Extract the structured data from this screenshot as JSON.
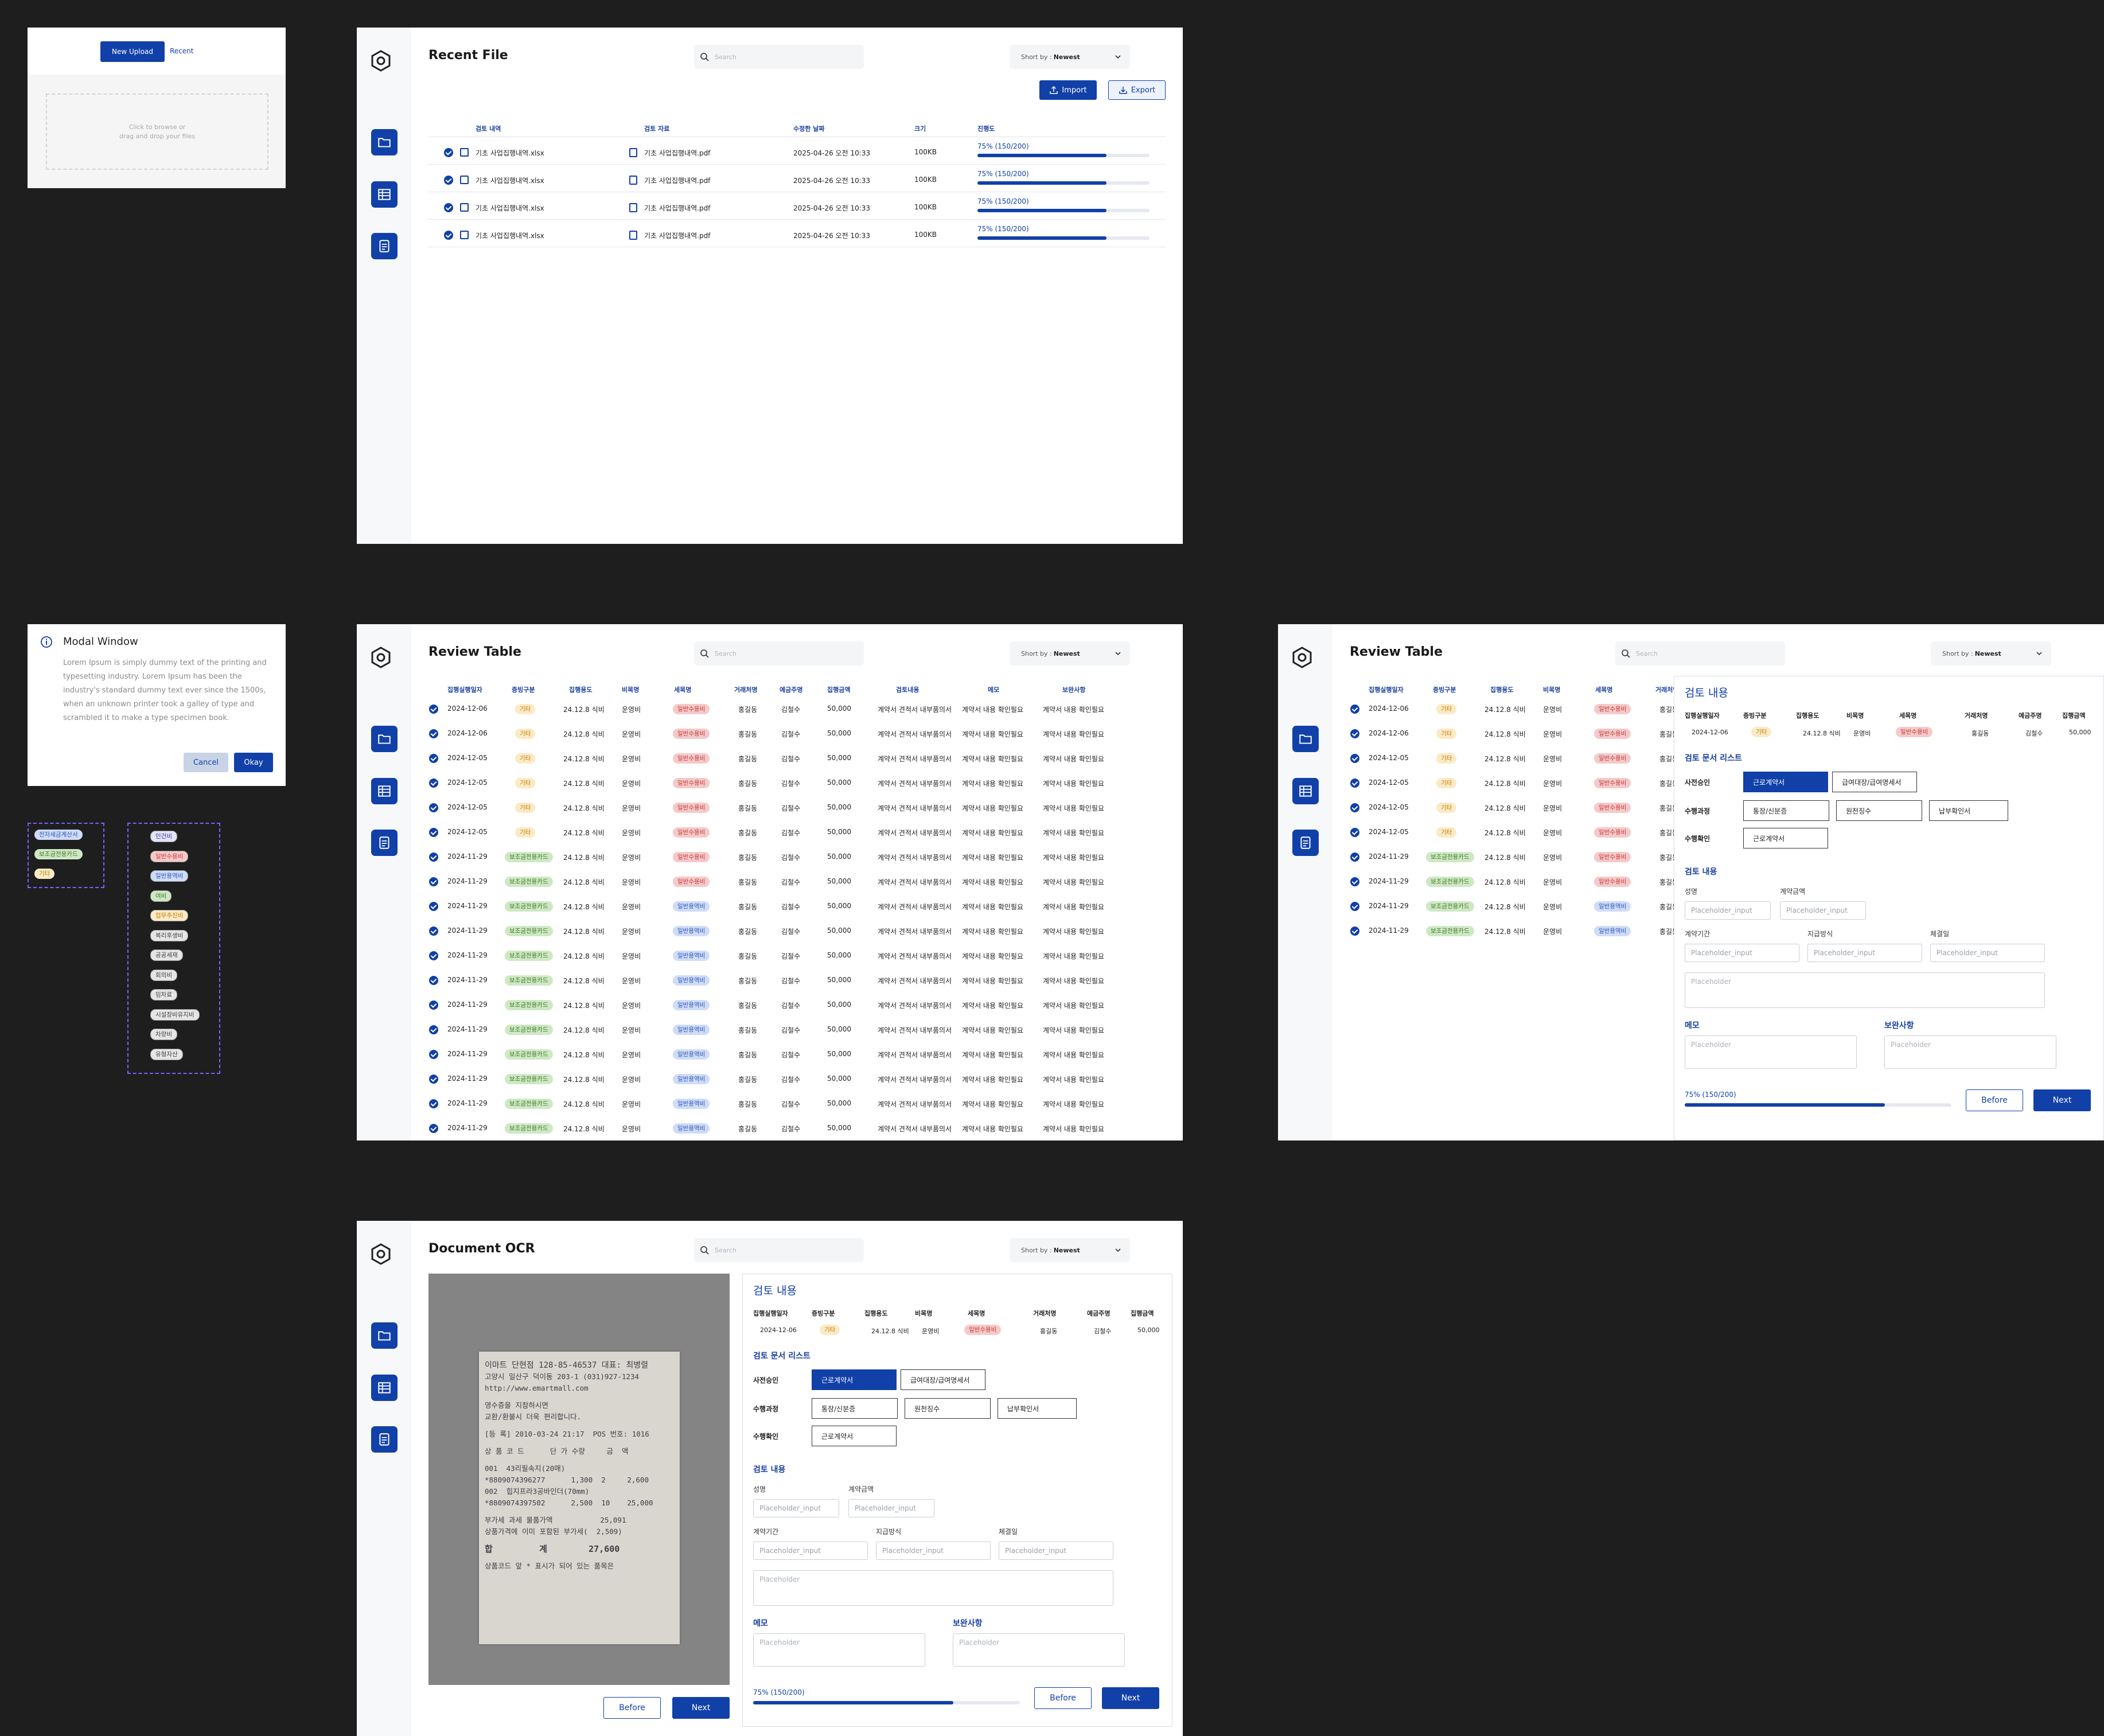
{
  "upload": {
    "tab_new": "New Upload",
    "tab_recent": "Recent",
    "drop_line1": "Click to browse or",
    "drop_line2": "drag and drop your files"
  },
  "modal": {
    "title": "Modal Window",
    "body": "Lorem Ipsum is simply dummy text of the printing and typesetting industry. Lorem Ipsum has been the industry's standard dummy text ever since the 1500s, when an unknown printer took a galley of type and scrambled it to make a type specimen book.",
    "cancel": "Cancel",
    "okay": "Okay"
  },
  "legend_a": [
    "전자세금계산서",
    "보조금전용카드",
    "기타"
  ],
  "legend_b": [
    "인건비",
    "일반수용비",
    "일반용역비",
    "여비",
    "업무추진비",
    "복리후생비",
    "공공세재",
    "회의비",
    "임차료",
    "시설장비유지비",
    "차량비",
    "유형자산"
  ],
  "common": {
    "search_placeholder": "Search",
    "sort_label": "Short by :",
    "sort_value": "Newest"
  },
  "recent": {
    "title": "Recent File",
    "import": "Import",
    "export": "Export",
    "columns": [
      "검토 내역",
      "검토 자료",
      "수정한 날짜",
      "크기",
      "진행도"
    ],
    "rows": [
      {
        "name": "기초 사업집행내역.xlsx",
        "doc": "기초 사업집행내역.pdf",
        "date": "2025-04-26 오전 10:33",
        "size": "100KB",
        "progress": "75% (150/200)",
        "pct": 0.75
      },
      {
        "name": "기초 사업집행내역.xlsx",
        "doc": "기초 사업집행내역.pdf",
        "date": "2025-04-26 오전 10:33",
        "size": "100KB",
        "progress": "75% (150/200)",
        "pct": 0.75
      },
      {
        "name": "기초 사업집행내역.xlsx",
        "doc": "기초 사업집행내역.pdf",
        "date": "2025-04-26 오전 10:33",
        "size": "100KB",
        "progress": "75% (150/200)",
        "pct": 0.75
      },
      {
        "name": "기초 사업집행내역.xlsx",
        "doc": "기초 사업집행내역.pdf",
        "date": "2025-04-26 오전 10:33",
        "size": "100KB",
        "progress": "75% (150/200)",
        "pct": 0.75
      }
    ]
  },
  "review": {
    "title": "Review Table",
    "columns": [
      "집행실행일자",
      "증빙구분",
      "집행용도",
      "비목명",
      "세목명",
      "거래처명",
      "예금주명",
      "집행금액",
      "검토내용",
      "메모",
      "보완사항"
    ],
    "rows": [
      {
        "date": "2024-12-06",
        "type": "기타",
        "tt": "y",
        "use": "24.12.8 식비",
        "item": "운영비",
        "sub": "일반수용비",
        "st": "r",
        "vendor": "홍길동",
        "holder": "김철수",
        "amount": "50,000",
        "review": "계약서 견적서 내부품의서",
        "memo": "계약서 내용 확인필요",
        "fix": "계약서 내용 확인필요"
      },
      {
        "date": "2024-12-06",
        "type": "기타",
        "tt": "y",
        "use": "24.12.8 식비",
        "item": "운영비",
        "sub": "일반수용비",
        "st": "r",
        "vendor": "홍길동",
        "holder": "김철수",
        "amount": "50,000",
        "review": "계약서 견적서 내부품의서",
        "memo": "계약서 내용 확인필요",
        "fix": "계약서 내용 확인필요"
      },
      {
        "date": "2024-12-05",
        "type": "기타",
        "tt": "y",
        "use": "24.12.8 식비",
        "item": "운영비",
        "sub": "일반수용비",
        "st": "r",
        "vendor": "홍길동",
        "holder": "김철수",
        "amount": "50,000",
        "review": "계약서 견적서 내부품의서",
        "memo": "계약서 내용 확인필요",
        "fix": "계약서 내용 확인필요"
      },
      {
        "date": "2024-12-05",
        "type": "기타",
        "tt": "y",
        "use": "24.12.8 식비",
        "item": "운영비",
        "sub": "일반수용비",
        "st": "r",
        "vendor": "홍길동",
        "holder": "김철수",
        "amount": "50,000",
        "review": "계약서 견적서 내부품의서",
        "memo": "계약서 내용 확인필요",
        "fix": "계약서 내용 확인필요"
      },
      {
        "date": "2024-12-05",
        "type": "기타",
        "tt": "y",
        "use": "24.12.8 식비",
        "item": "운영비",
        "sub": "일반수용비",
        "st": "r",
        "vendor": "홍길동",
        "holder": "김철수",
        "amount": "50,000",
        "review": "계약서 견적서 내부품의서",
        "memo": "계약서 내용 확인필요",
        "fix": "계약서 내용 확인필요"
      },
      {
        "date": "2024-12-05",
        "type": "기타",
        "tt": "y",
        "use": "24.12.8 식비",
        "item": "운영비",
        "sub": "일반수용비",
        "st": "r",
        "vendor": "홍길동",
        "holder": "김철수",
        "amount": "50,000",
        "review": "계약서 견적서 내부품의서",
        "memo": "계약서 내용 확인필요",
        "fix": "계약서 내용 확인필요"
      },
      {
        "date": "2024-11-29",
        "type": "보조금전용카드",
        "tt": "g",
        "use": "24.12.8 식비",
        "item": "운영비",
        "sub": "일반수용비",
        "st": "r",
        "vendor": "홍길동",
        "holder": "김철수",
        "amount": "50,000",
        "review": "계약서 견적서 내부품의서",
        "memo": "계약서 내용 확인필요",
        "fix": "계약서 내용 확인필요"
      },
      {
        "date": "2024-11-29",
        "type": "보조금전용카드",
        "tt": "g",
        "use": "24.12.8 식비",
        "item": "운영비",
        "sub": "일반수용비",
        "st": "r",
        "vendor": "홍길동",
        "holder": "김철수",
        "amount": "50,000",
        "review": "계약서 견적서 내부품의서",
        "memo": "계약서 내용 확인필요",
        "fix": "계약서 내용 확인필요"
      },
      {
        "date": "2024-11-29",
        "type": "보조금전용카드",
        "tt": "g",
        "use": "24.12.8 식비",
        "item": "운영비",
        "sub": "일반용역비",
        "st": "b",
        "vendor": "홍길동",
        "holder": "김철수",
        "amount": "50,000",
        "review": "계약서 견적서 내부품의서",
        "memo": "계약서 내용 확인필요",
        "fix": "계약서 내용 확인필요"
      },
      {
        "date": "2024-11-29",
        "type": "보조금전용카드",
        "tt": "g",
        "use": "24.12.8 식비",
        "item": "운영비",
        "sub": "일반용역비",
        "st": "b",
        "vendor": "홍길동",
        "holder": "김철수",
        "amount": "50,000",
        "review": "계약서 견적서 내부품의서",
        "memo": "계약서 내용 확인필요",
        "fix": "계약서 내용 확인필요"
      },
      {
        "date": "2024-11-29",
        "type": "보조금전용카드",
        "tt": "g",
        "use": "24.12.8 식비",
        "item": "운영비",
        "sub": "일반용역비",
        "st": "b",
        "vendor": "홍길동",
        "holder": "김철수",
        "amount": "50,000",
        "review": "계약서 견적서 내부품의서",
        "memo": "계약서 내용 확인필요",
        "fix": "계약서 내용 확인필요"
      },
      {
        "date": "2024-11-29",
        "type": "보조금전용카드",
        "tt": "g",
        "use": "24.12.8 식비",
        "item": "운영비",
        "sub": "일반용역비",
        "st": "b",
        "vendor": "홍길동",
        "holder": "김철수",
        "amount": "50,000",
        "review": "계약서 견적서 내부품의서",
        "memo": "계약서 내용 확인필요",
        "fix": "계약서 내용 확인필요"
      },
      {
        "date": "2024-11-29",
        "type": "보조금전용카드",
        "tt": "g",
        "use": "24.12.8 식비",
        "item": "운영비",
        "sub": "일반용역비",
        "st": "b",
        "vendor": "홍길동",
        "holder": "김철수",
        "amount": "50,000",
        "review": "계약서 견적서 내부품의서",
        "memo": "계약서 내용 확인필요",
        "fix": "계약서 내용 확인필요"
      },
      {
        "date": "2024-11-29",
        "type": "보조금전용카드",
        "tt": "g",
        "use": "24.12.8 식비",
        "item": "운영비",
        "sub": "일반용역비",
        "st": "b",
        "vendor": "홍길동",
        "holder": "김철수",
        "amount": "50,000",
        "review": "계약서 견적서 내부품의서",
        "memo": "계약서 내용 확인필요",
        "fix": "계약서 내용 확인필요"
      },
      {
        "date": "2024-11-29",
        "type": "보조금전용카드",
        "tt": "g",
        "use": "24.12.8 식비",
        "item": "운영비",
        "sub": "일반용역비",
        "st": "b",
        "vendor": "홍길동",
        "holder": "김철수",
        "amount": "50,000",
        "review": "계약서 견적서 내부품의서",
        "memo": "계약서 내용 확인필요",
        "fix": "계약서 내용 확인필요"
      },
      {
        "date": "2024-11-29",
        "type": "보조금전용카드",
        "tt": "g",
        "use": "24.12.8 식비",
        "item": "운영비",
        "sub": "일반용역비",
        "st": "b",
        "vendor": "홍길동",
        "holder": "김철수",
        "amount": "50,000",
        "review": "계약서 견적서 내부품의서",
        "memo": "계약서 내용 확인필요",
        "fix": "계약서 내용 확인필요"
      },
      {
        "date": "2024-11-29",
        "type": "보조금전용카드",
        "tt": "g",
        "use": "24.12.8 식비",
        "item": "운영비",
        "sub": "일반용역비",
        "st": "b",
        "vendor": "홍길동",
        "holder": "김철수",
        "amount": "50,000",
        "review": "계약서 견적서 내부품의서",
        "memo": "계약서 내용 확인필요",
        "fix": "계약서 내용 확인필요"
      },
      {
        "date": "2024-11-29",
        "type": "보조금전용카드",
        "tt": "g",
        "use": "24.12.8 식비",
        "item": "운영비",
        "sub": "일반용역비",
        "st": "b",
        "vendor": "홍길동",
        "holder": "김철수",
        "amount": "50,000",
        "review": "계약서 견적서 내부품의서",
        "memo": "계약서 내용 확인필요",
        "fix": "계약서 내용 확인필요"
      }
    ]
  },
  "review_panel": {
    "columns_visible": [
      "집행실행일자",
      "증빙구분",
      "집행용도",
      "비목명",
      "세목명",
      "거래처"
    ],
    "rows_count": 10
  },
  "detail": {
    "title": "검토 내용",
    "summary_cols": [
      "집행실행일자",
      "증빙구분",
      "집행용도",
      "비목명",
      "세목명",
      "거래처명",
      "예금주명",
      "집행금액"
    ],
    "summary_vals": [
      "2024-12-06",
      "기타",
      "24.12.8 식비",
      "운영비",
      "일반수용비",
      "홍길동",
      "김철수",
      "50,000"
    ],
    "doclist_title": "검토 문서 리스트",
    "groups": [
      {
        "label": "사전승인",
        "options": [
          "근로계약서",
          "급여대장/급여명세서"
        ]
      },
      {
        "label": "수행과정",
        "options": [
          "통장/신분증",
          "원천징수",
          "납부확인서"
        ]
      },
      {
        "label": "수행확인",
        "options": [
          "근로계약서"
        ]
      }
    ],
    "review_title": "검토 내용",
    "name_label": "성명",
    "contract_amount_label": "계약금액",
    "period_label": "계약기간",
    "pay_label": "지급방식",
    "sign_label": "체결일",
    "input_placeholder": "Placeholder_input",
    "ta_placeholder": "Placeholder",
    "memo_title": "메모",
    "fix_title": "보완사항",
    "progress": "75% (150/200)",
    "pct": 0.75,
    "before": "Before",
    "next": "Next"
  },
  "ocr": {
    "title": "Document OCR",
    "before": "Before",
    "next": "Next",
    "receipt_lines": [
      "이마트 단현점 128-85-46537 대표: 최병렬",
      "고양시 일산구 덕이동 203-1 (031)927-1234",
      "http://www.emartmall.com",
      "영수증을 지참하시면",
      "교환/환불시 더욱 편리합니다.",
      "[등 록] 2010-03-24 21:17  POS 번호: 1016",
      "상 품 코 드      단 가 수량     금  액",
      "001  43리필속지(20매)",
      "*8809074396277      1,300  2     2,600",
      "002  힙지프라3공바인더(70mm)",
      "*8809074397502      2,500  10    25,000",
      "부가세 과세 물품가액           25,091",
      "상품가격에 이미 포함된 부가세(  2,509)",
      "합         계        27,600",
      "상품코드 앞 * 표시가 되어 있는 품목은"
    ]
  },
  "colors": {
    "primary": "#1140a8",
    "bg": "#1e1e1e"
  }
}
